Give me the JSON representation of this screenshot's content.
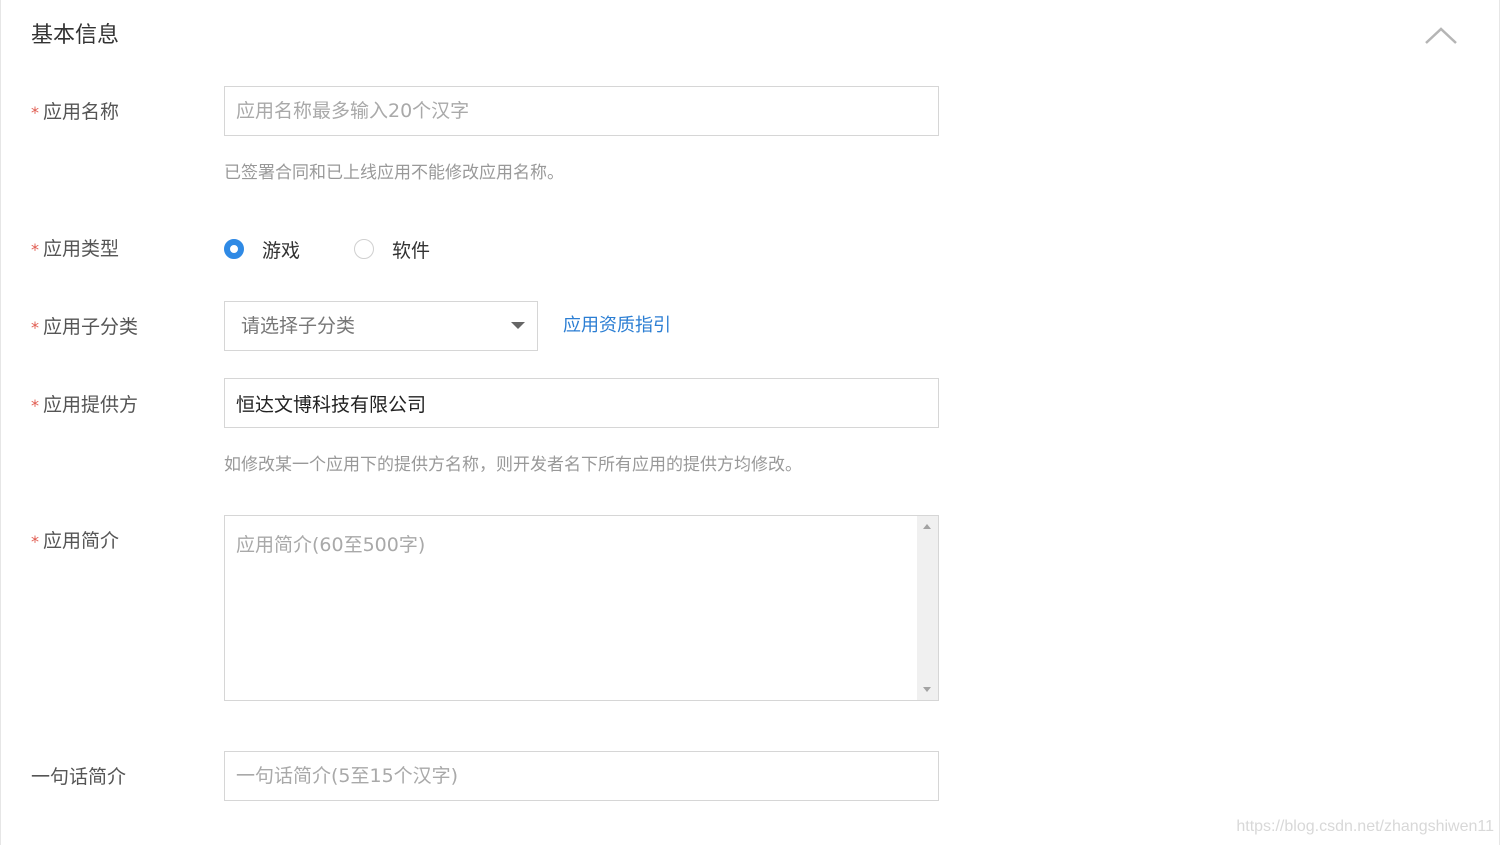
{
  "section": {
    "title": "基本信息",
    "collapse_icon": "chevron-up-icon"
  },
  "required_mark": "*",
  "form": {
    "app_name": {
      "label": "应用名称",
      "placeholder": "应用名称最多输入20个汉字",
      "value": "",
      "hint": "已签署合同和已上线应用不能修改应用名称。"
    },
    "app_type": {
      "label": "应用类型",
      "options": [
        {
          "label": "游戏",
          "checked": true
        },
        {
          "label": "软件",
          "checked": false
        }
      ]
    },
    "app_subcategory": {
      "label": "应用子分类",
      "selected": "请选择子分类",
      "link": "应用资质指引"
    },
    "app_provider": {
      "label": "应用提供方",
      "value": "恒达文博科技有限公司",
      "hint": "如修改某一个应用下的提供方名称，则开发者名下所有应用的提供方均修改。"
    },
    "app_intro": {
      "label": "应用简介",
      "placeholder": "应用简介(60至500字)",
      "value": ""
    },
    "one_line_intro": {
      "label": "一句话简介",
      "placeholder": "一句话简介(5至15个汉字)",
      "value": ""
    }
  },
  "watermark": "https://blog.csdn.net/zhangshiwen11",
  "colors": {
    "accent": "#2f8ae5",
    "link": "#2b7ed3",
    "required": "#e05a4e",
    "hint": "#999999",
    "border": "#d6d6d6"
  }
}
